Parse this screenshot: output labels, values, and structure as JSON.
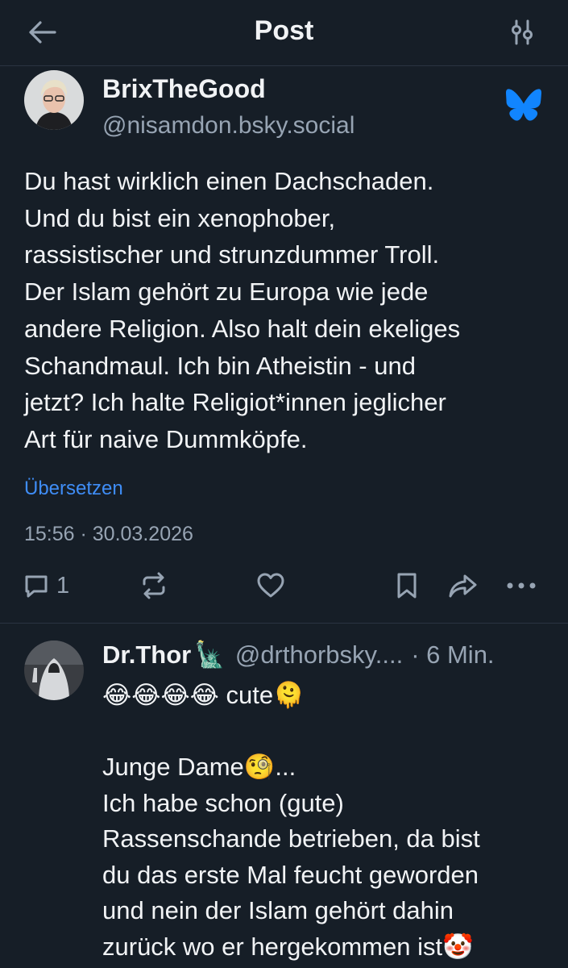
{
  "header": {
    "title": "Post",
    "back_icon": "arrow-left-icon",
    "settings_icon": "sliders-icon"
  },
  "post": {
    "author_name": "BrixTheGood",
    "author_handle": "@nisamdon.bsky.social",
    "body": "Du hast wirklich einen Dachschaden.\nUnd du bist ein xenophober,\nrassistischer und strunzdummer Troll.\nDer Islam gehört zu Europa wie jede\nandere Religion. Also halt dein ekeliges\nSchandmaul. Ich bin Atheistin - und\njetzt? Ich halte Religiot*innen jeglicher\nArt für naive Dummköpfe.",
    "translate_label": "Übersetzen",
    "timestamp": "15:56 · 30.03.2026",
    "reply_count": "1",
    "logo_icon": "bluesky-butterfly-icon"
  },
  "reply": {
    "author_name": "Dr.Thor",
    "author_emoji": "🗽",
    "author_handle": "@drthorbsky....",
    "time": "· 6 Min.",
    "body": "😂😂😂😂 cute🫠\n\nJunge Dame🧐...\nIch habe schon (gute)\nRassenschande betrieben, da bist\ndu das erste Mal feucht geworden\nund nein der Islam gehört dahin\nzurück wo er hergekommen ist🤡"
  },
  "colors": {
    "background": "#161e27",
    "text": "#f1f3f5",
    "muted": "#97a4b3",
    "link": "#3f8df6",
    "bluesky_logo": "#1185fe"
  }
}
